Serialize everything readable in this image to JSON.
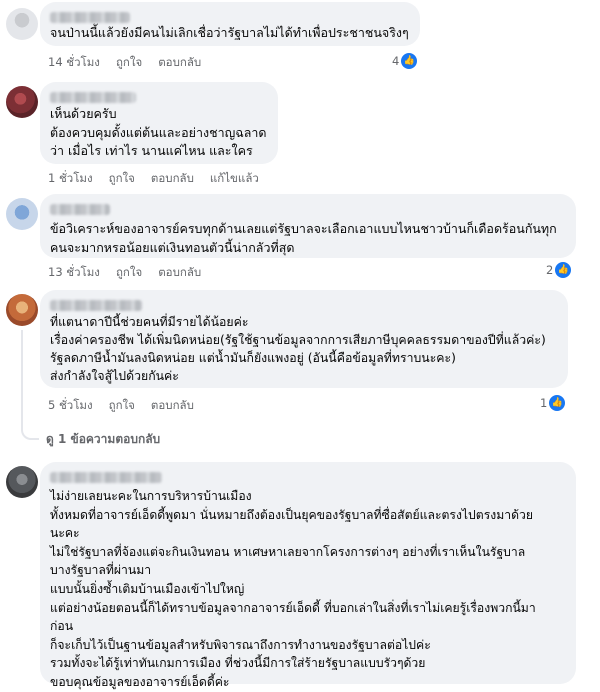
{
  "comments": [
    {
      "text": "จนป่านนี้แล้วยังมีคนไม่เลิกเชื่อว่ารัฐบาลไม่ได้ทำเพื่อประชาชนจริงๆ",
      "time": "14 ชั่วโมง",
      "like_label": "ถูกใจ",
      "reply_label": "ตอบกลับ",
      "reaction_count": "4"
    },
    {
      "text": "เห็นด้วยครับ\nต้องควบคุมดั้งแต่ต้นและอย่างชาญฉลาด\nว่า เมื่อไร เท่าไร นานแค่ไหน และใคร",
      "time": "1 ชั่วโมง",
      "like_label": "ถูกใจ",
      "reply_label": "ตอบกลับ",
      "edited_label": "แก้ไขแล้ว"
    },
    {
      "text": "ข้อวิเคราะห์ของอาจารย์ครบทุกด้านเลยแต่รัฐบาลจะเลือกเอาแบบไหนชาวบ้านก็เดือดร้อนกันทุก\nคนจะมากหรอน้อยแต่เงินทอนตัวนี้น่ากลัวที่สุด",
      "time": "13 ชั่วโมง",
      "like_label": "ถูกใจ",
      "reply_label": "ตอบกลับ",
      "reaction_count": "2"
    },
    {
      "text": "ที่แตนาดาปีนี้ช่วยคนที่มีรายได้น้อยค่ะ\nเรื่องค่าครองชีพ ได้เพิ่มนิดหน่อย(รัฐใช้ฐานข้อมูลจากการเสียภาษีบุคคลธรรมดาของปีที่แล้วค่ะ)\nรัฐลดภาษีน้ำมันลงนิดหน่อย แต่น้ำมันก็ยังแพงอยู่ (อันนี้คือข้อมูลที่ทราบนะคะ)\nส่งกำลังใจสู้ไปด้วยกันค่ะ",
      "time": "5 ชั่วโมง",
      "like_label": "ถูกใจ",
      "reply_label": "ตอบกลับ",
      "reaction_count": "1",
      "view_replies": "ดู 1 ข้อความตอบกลับ"
    },
    {
      "text": "ไม่ง่ายเลยนะคะในการบริหารบ้านเมือง\nทั้งหมดที่อาจารย์เอ็ดดี้พูดมา นั่นหมายถึงต้องเป็นยุคของรัฐบาลที่ซื่อสัตย์และตรงไปตรงมาด้วย\nนะคะ\nไม่ใช่รัฐบาลที่จ้องแต่จะกินเงินทอน หาเศษหาเลยจากโครงการต่างๆ อย่างที่เราเห็นในรัฐบาล\nบางรัฐบาลที่ผ่านมา\nแบบนั้นยิ่งซ้ำเติมบ้านเมืองเข้าไปใหญ่\nแต่อย่างน้อยตอนนี้ก็ได้ทราบข้อมูลจากอาจารย์เอ็ดดี้ ที่บอกเล่าในสิ่งที่เราไม่เคยรู้เรื่องพวกนี้มา\nก่อน\nก็จะเก็บไว้เป็นฐานข้อมูลสำหรับพิจารณาถึงการทำงานของรัฐบาลต่อไปค่ะ\nรวมทั้งจะได้รู้เท่าทันเกมการเมือง ที่ช่วงนี้มีการใส่ร้ายรัฐบาลแบบรัวๆด้วย\nขอบคุณข้อมูลของอาจารย์เอ็ดดี้ค่ะ"
    }
  ],
  "icons": {
    "like": "thumbs-up-icon"
  },
  "colors": {
    "bubble": "#f0f2f5",
    "meta": "#65676b",
    "like_blue": "#1877f2"
  }
}
